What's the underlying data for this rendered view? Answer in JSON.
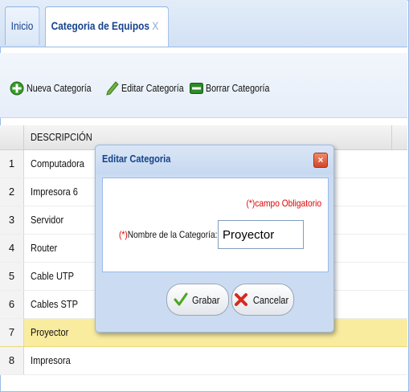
{
  "tabs": {
    "home": "Inicio",
    "active": "Categoria de Equipos",
    "active_close": "X"
  },
  "toolbar": {
    "new_label": "Nueva Categoría",
    "edit_label": "Editar Categoría",
    "delete_label": "Borrar Categoría"
  },
  "grid": {
    "column_header": "DESCRIPCIÓN",
    "rows": [
      {
        "num": "1",
        "description": "Computadora"
      },
      {
        "num": "2",
        "description": "Impresora 6"
      },
      {
        "num": "3",
        "description": "Servidor"
      },
      {
        "num": "4",
        "description": "Router"
      },
      {
        "num": "5",
        "description": "Cable UTP"
      },
      {
        "num": "6",
        "description": "Cables STP"
      },
      {
        "num": "7",
        "description": "Proyector"
      },
      {
        "num": "8",
        "description": "Impresora"
      }
    ],
    "selected_row": "7"
  },
  "dialog": {
    "title": "Editar Categoria",
    "required_note": "(*)campo Obligatorio",
    "field_required_mark": "(*)",
    "field_label": "Nombre de la Categoría:",
    "field_value": "Proyector",
    "save_label": "Grabar",
    "cancel_label": "Cancelar"
  },
  "colors": {
    "header_text": "#15428b",
    "selected_row": "#faec9e",
    "required": "#e00000",
    "border": "#99bbe8"
  }
}
